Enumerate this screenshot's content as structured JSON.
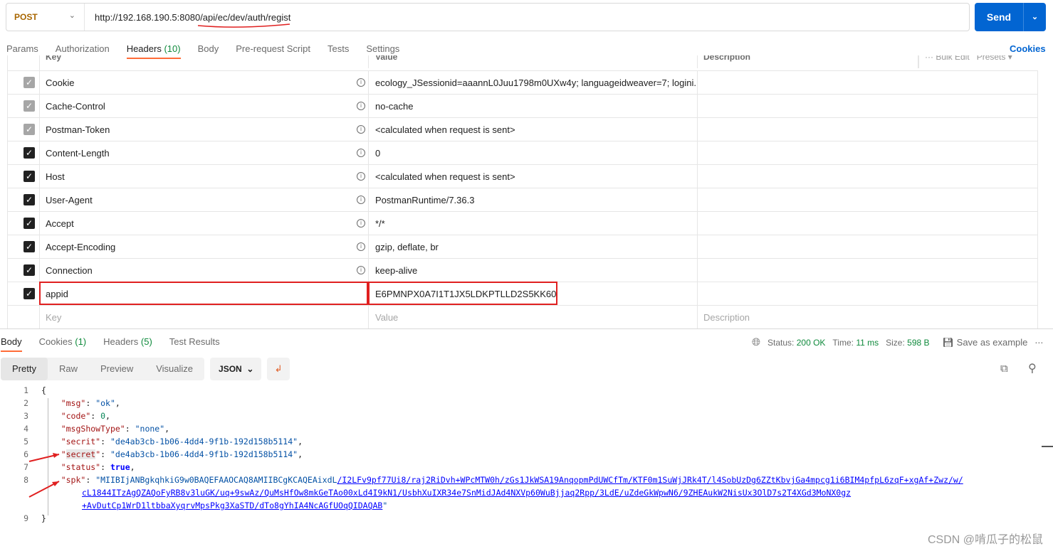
{
  "request": {
    "method": "POST",
    "url": "http://192.168.190.5:8080/api/ec/dev/auth/regist",
    "url_host": "http://192.168.190.5:8080",
    "url_path": "/api/ec/dev/auth/regist",
    "send_label": "Send"
  },
  "tabs": [
    {
      "label": "Params"
    },
    {
      "label": "Authorization"
    },
    {
      "label": "Headers",
      "count": "(10)"
    },
    {
      "label": "Body"
    },
    {
      "label": "Pre-request Script"
    },
    {
      "label": "Tests"
    },
    {
      "label": "Settings"
    }
  ],
  "cookies_link": "Cookies",
  "headers_table": {
    "columns": [
      "Key",
      "Value",
      "Description"
    ],
    "bulk_edit": "Bulk Edit",
    "presets": "Presets",
    "rows": [
      {
        "key": "Cookie",
        "value": "ecology_JSessionid=aaannL0Juu1798m0UXw4y; languageidweaver=7; logini...",
        "checked": true,
        "auto": true
      },
      {
        "key": "Cache-Control",
        "value": "no-cache",
        "checked": true,
        "auto": true
      },
      {
        "key": "Postman-Token",
        "value": "<calculated when request is sent>",
        "checked": true,
        "auto": true
      },
      {
        "key": "Content-Length",
        "value": "0",
        "checked": true
      },
      {
        "key": "Host",
        "value": "<calculated when request is sent>",
        "checked": true
      },
      {
        "key": "User-Agent",
        "value": "PostmanRuntime/7.36.3",
        "checked": true
      },
      {
        "key": "Accept",
        "value": "*/*",
        "checked": true
      },
      {
        "key": "Accept-Encoding",
        "value": "gzip, deflate, br",
        "checked": true
      },
      {
        "key": "Connection",
        "value": "keep-alive",
        "checked": true
      },
      {
        "key": "appid",
        "value": "E6PMNPX0A7I1T1JX5LDKPTLLD2S5KK60",
        "checked": true
      }
    ],
    "placeholder": {
      "key": "Key",
      "value": "Value",
      "description": "Description"
    }
  },
  "response": {
    "tabs": [
      {
        "label": "Body"
      },
      {
        "label": "Cookies",
        "count": "(1)"
      },
      {
        "label": "Headers",
        "count": "(5)"
      },
      {
        "label": "Test Results"
      }
    ],
    "status_label": "Status:",
    "status": "200 OK",
    "time_label": "Time:",
    "time": "11 ms",
    "size_label": "Size:",
    "size": "598 B",
    "save_example": "Save as example",
    "views": [
      "Pretty",
      "Raw",
      "Preview",
      "Visualize"
    ],
    "format": "JSON",
    "body": {
      "msg": "ok",
      "code": "0",
      "msgShowType": "none",
      "secrit": "de4ab3cb-1b06-4dd4-9f1b-192d158b5114",
      "secret": "de4ab3cb-1b06-4dd4-9f1b-192d158b5114",
      "status": "true",
      "spk_start": "MIIBIjANBgkqhkiG9w0BAQEFAAOCAQ8AMIIBCgKCAQEAixdL",
      "spk_link_1": "/I2LFv9pf77Ui8/raj2RiDvh+WPcMTW0h/zGs1JkWSA19AnqopmPdUWCfTm/KTF0m1SuWjJRk4T/l4SobUzDg6ZZtKbvjGa4mpcg1i6BIM4pfpL6zqF+xgAf+Zwz/w/",
      "spk_link_2": "cL1844ITzAgQZAQoFyRB8v3luGK/uq+9swAz/QuMsHfOw8mkGeTAo00xLd4I9kN1/UsbhXuIXR34e7SnMidJAd4NXVp60WuBjjaq2Rpp/3LdE/uZdeGkWpwN6/9ZHEAukW2NisUx3OlD7s2T4XGd3MoNX0gz",
      "spk_link_3": "+AvDutCp1WrD1ltbbaXyqrvMpsPkg3XaSTD/dTo8gYhIA4NcAGfUOqQIDAQAB"
    }
  },
  "watermark": "CSDN @啃瓜子的松鼠",
  "colors": {
    "accent": "#0265d2",
    "tab_underline": "#ff6c37",
    "annotation": "#e02020",
    "ok": "#0f8a3c"
  }
}
